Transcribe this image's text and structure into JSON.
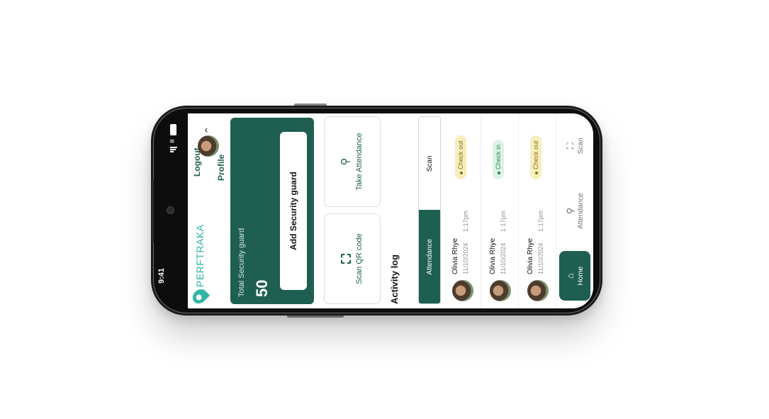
{
  "status": {
    "time": "9:41"
  },
  "brand": {
    "name": "PERFTRAKA"
  },
  "header": {
    "logout_label": "Logout",
    "profile_label": "Profile"
  },
  "hero": {
    "total_label": "Total Security guard",
    "total_count": "50",
    "add_button_label": "Add Security guard"
  },
  "actions": {
    "scan_label": "Scan QR code",
    "attendance_label": "Take Attendance"
  },
  "activity": {
    "title": "Activity log",
    "tabs": [
      {
        "label": "Attendance",
        "active": true
      },
      {
        "label": "Scan",
        "active": false
      }
    ],
    "rows": [
      {
        "name": "Olivia Rhye",
        "date": "11/10/2024",
        "time": "1:17pm",
        "status": "Check out"
      },
      {
        "name": "Olivia Rhye",
        "date": "11/10/2024",
        "time": "1:17pm",
        "status": "Check in"
      },
      {
        "name": "Olivia Rhye",
        "date": "11/10/2024",
        "time": "1:17pm",
        "status": "Check out"
      }
    ]
  },
  "nav": {
    "items": [
      {
        "label": "Home",
        "icon": "home-icon",
        "active": true
      },
      {
        "label": "Attendance",
        "icon": "person-icon",
        "active": false
      },
      {
        "label": "Scan",
        "icon": "scan-icon",
        "active": false
      }
    ]
  },
  "colors": {
    "primary": "#1e5f52",
    "brand": "#2fb5a3",
    "check_out_bg": "#f6eebd",
    "check_in_bg": "#dcf3e3"
  }
}
